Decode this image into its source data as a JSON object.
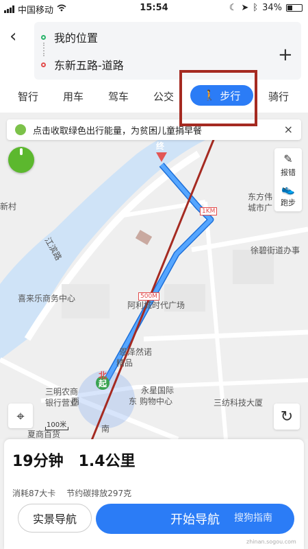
{
  "status_bar": {
    "carrier": "中国移动",
    "time": "15:54",
    "battery": "34%"
  },
  "route": {
    "origin": "我的位置",
    "destination": "东新五路-道路"
  },
  "modes": [
    "智行",
    "用车",
    "驾车",
    "公交",
    "步行",
    "骑行"
  ],
  "active_mode": "步行",
  "banner": {
    "text": "点击收取绿色出行能量，为贫困儿童捐早餐",
    "close": "×"
  },
  "side_tools": {
    "report": "报错",
    "run": "跑步"
  },
  "map": {
    "labels": {
      "end": "终",
      "start": "起",
      "north": "北",
      "west": "西",
      "east": "东",
      "south": "南",
      "xincun": "新村",
      "dongfangwei": "东方伟",
      "chengshiguang": "城市广",
      "xubi_office": "徐碧街道办事",
      "xilaile": "喜来乐商务中心",
      "times_square": "阿利城时代广场",
      "enzesi": "恩泽然诺",
      "jingpin": "精品",
      "sanming_bank": "三明农商",
      "bank_office": "银行营业",
      "yongxing": "永星国际",
      "shopping": "购物中心",
      "sanfang": "三纺科技大厦",
      "xiashang": "夏商百货",
      "jiangbin_road": "江滨路",
      "road_marker_1km": "1KM",
      "road_marker_500m": "500M",
      "scale": "100米"
    }
  },
  "summary": {
    "duration": "19分钟",
    "distance": "1.4公里"
  },
  "details": {
    "calories": "消耗87大卡",
    "carbon": "节约碳排放297克"
  },
  "buttons": {
    "ar_nav": "实景导航",
    "start_nav": "开始导航"
  },
  "watermark": {
    "text": "搜狗指南",
    "sub": "zhinan.sogou.com"
  },
  "colors": {
    "accent": "#2b7cf6",
    "route": "#3d8ff0",
    "annotation": "#a52a21",
    "river": "#cfe3f7"
  }
}
